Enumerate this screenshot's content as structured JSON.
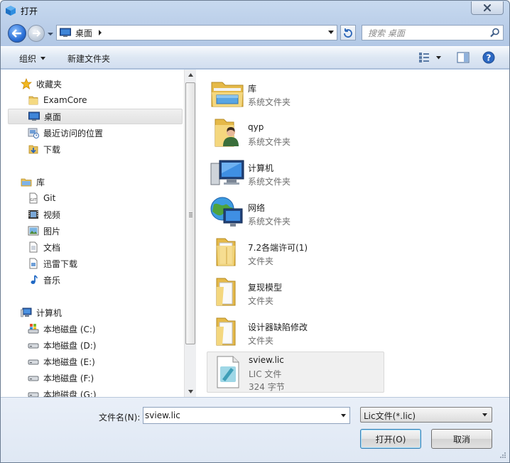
{
  "window": {
    "title": "打开"
  },
  "address": {
    "location": "桌面",
    "search_placeholder": "搜索 桌面"
  },
  "toolbar": {
    "organize": "组织",
    "new_folder": "新建文件夹"
  },
  "nav": {
    "favorites": {
      "label": "收藏夹",
      "items": [
        {
          "label": "ExamCore",
          "icon": "folder-icon"
        },
        {
          "label": "桌面",
          "icon": "desktop-icon",
          "selected": true
        },
        {
          "label": "最近访问的位置",
          "icon": "recent-places-icon"
        },
        {
          "label": "下载",
          "icon": "downloads-icon"
        }
      ]
    },
    "libraries": {
      "label": "库",
      "items": [
        {
          "label": "Git",
          "icon": "git-icon"
        },
        {
          "label": "视频",
          "icon": "video-icon"
        },
        {
          "label": "图片",
          "icon": "pictures-icon"
        },
        {
          "label": "文档",
          "icon": "documents-icon"
        },
        {
          "label": "迅雷下载",
          "icon": "thunder-download-icon"
        },
        {
          "label": "音乐",
          "icon": "music-icon"
        }
      ]
    },
    "computer": {
      "label": "计算机",
      "items": [
        {
          "label": "本地磁盘 (C:)",
          "icon": "system-drive-icon"
        },
        {
          "label": "本地磁盘 (D:)",
          "icon": "drive-icon"
        },
        {
          "label": "本地磁盘 (E:)",
          "icon": "drive-icon"
        },
        {
          "label": "本地磁盘 (F:)",
          "icon": "drive-icon"
        },
        {
          "label": "本地磁盘 (G:)",
          "icon": "drive-icon"
        }
      ]
    }
  },
  "files": [
    {
      "name": "库",
      "type": "系统文件夹",
      "icon": "library-folder-icon"
    },
    {
      "name": "qyp",
      "type": "系统文件夹",
      "icon": "user-folder-icon"
    },
    {
      "name": "计算机",
      "type": "系统文件夹",
      "icon": "computer-icon"
    },
    {
      "name": "网络",
      "type": "系统文件夹",
      "icon": "network-icon"
    },
    {
      "name": "7.2各端许可(1)",
      "type": "文件夹",
      "icon": "folder-icon"
    },
    {
      "name": "复现模型",
      "type": "文件夹",
      "icon": "folder-icon"
    },
    {
      "name": "设计器缺陷修改",
      "type": "文件夹",
      "icon": "folder-icon"
    },
    {
      "name": "sview.lic",
      "type": "LIC 文件",
      "size": "324 字节",
      "icon": "lic-file-icon",
      "selected": true
    }
  ],
  "bottom": {
    "filename_label": "文件名(N):",
    "filename_value": "sview.lic",
    "filetype_value": "Lic文件(*.lic)",
    "open_button": "打开(O)",
    "cancel_button": "取消"
  }
}
